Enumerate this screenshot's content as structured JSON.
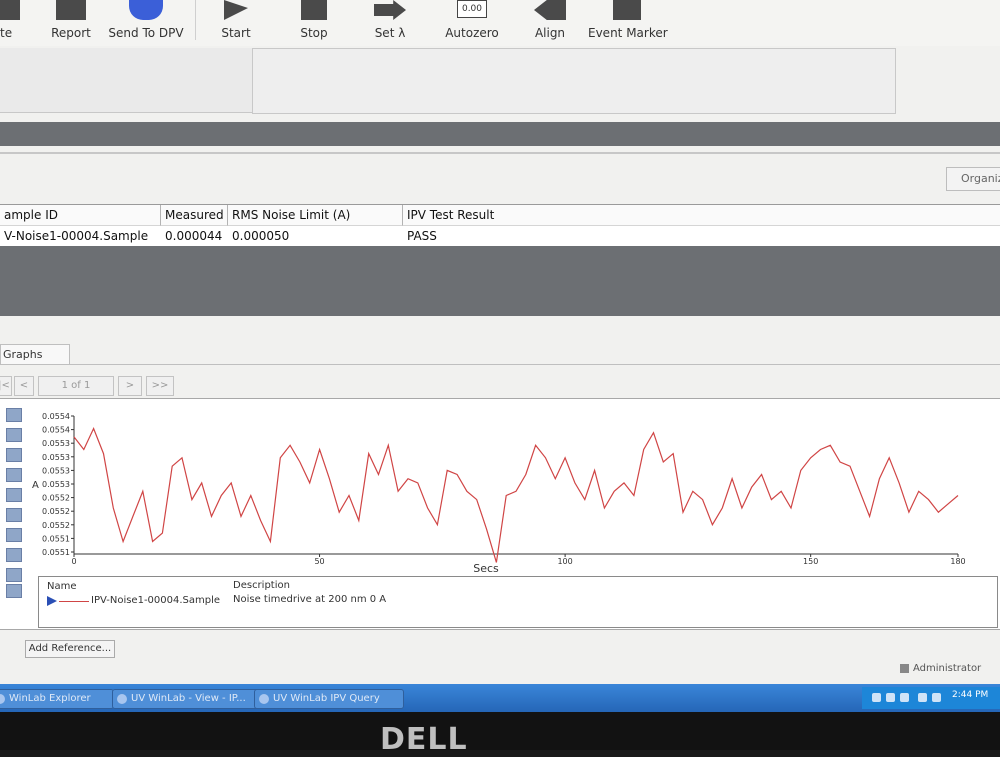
{
  "toolbar": {
    "buttons": [
      {
        "label": "te",
        "icon": "generic-icon"
      },
      {
        "label": "Report",
        "icon": "report-icon"
      },
      {
        "label": "Send To DPV",
        "icon": "send-icon"
      },
      {
        "label": "Start",
        "icon": "play-icon"
      },
      {
        "label": "Stop",
        "icon": "stop-icon"
      },
      {
        "label": "Set λ",
        "icon": "arrow-icon"
      },
      {
        "label": "Autozero",
        "icon": "autozero-icon",
        "icon_text": "0.00"
      },
      {
        "label": "Align",
        "icon": "align-icon"
      },
      {
        "label": "Event Marker",
        "icon": "marker-icon"
      }
    ]
  },
  "organize_label": "Organiz",
  "results": {
    "headers": [
      "ample ID",
      "Measured",
      "RMS Noise Limit (A)",
      "IPV Test Result"
    ],
    "rows": [
      [
        "V-Noise1-00004.Sample",
        "0.000044",
        "0.000050",
        "PASS"
      ]
    ]
  },
  "graphs": {
    "tab_label": "Graphs",
    "pager": {
      "first": "|<",
      "prev": "<",
      "page_text": "1 of 1",
      "next": ">",
      "last": ">>"
    },
    "add_reference": "Add Reference...",
    "legend": {
      "name_header": "Name",
      "description_header": "Description",
      "entry_name": "IPV-Noise1-00004.Sample",
      "entry_description": "Noise timedrive at 200 nm 0 A"
    }
  },
  "chart_data": {
    "type": "line",
    "xlabel": "Secs",
    "ylabel": "A",
    "xlim": [
      0,
      180
    ],
    "ylim": [
      0.05509,
      0.05542
    ],
    "x_ticks": [
      0,
      50,
      100,
      150,
      180
    ],
    "y_ticks": [
      "0.0554",
      "0.0554",
      "0.0553",
      "0.0553",
      "0.0553",
      "0.0553",
      "0.0552",
      "0.0552",
      "0.0552",
      "0.0551",
      "0.0551"
    ],
    "series_color": "#d04545",
    "series": [
      {
        "x": [
          0,
          2,
          4,
          6,
          8,
          10,
          12,
          14,
          16,
          18,
          20,
          22,
          24,
          26,
          28,
          30,
          32,
          34,
          36,
          38,
          40,
          42,
          44,
          46,
          48,
          50,
          52,
          54,
          56,
          58,
          60,
          62,
          64,
          66,
          68,
          70,
          72,
          74,
          76,
          78,
          80,
          82,
          84,
          86,
          88,
          90,
          92,
          94,
          96,
          98,
          100,
          102,
          104,
          106,
          108,
          110,
          112,
          114,
          116,
          118,
          120,
          122,
          124,
          126,
          128,
          130,
          132,
          134,
          136,
          138,
          140,
          142,
          144,
          146,
          148,
          150,
          152,
          154,
          156,
          158,
          160,
          162,
          164,
          166,
          168,
          170,
          172,
          174,
          176,
          178,
          180
        ],
        "y": [
          0.05537,
          0.05534,
          0.05539,
          0.05533,
          0.0552,
          0.05512,
          0.05518,
          0.05524,
          0.05512,
          0.05514,
          0.0553,
          0.05532,
          0.05522,
          0.05526,
          0.05518,
          0.05523,
          0.05526,
          0.05518,
          0.05523,
          0.05517,
          0.05512,
          0.05532,
          0.05535,
          0.05531,
          0.05526,
          0.05534,
          0.05527,
          0.05519,
          0.05523,
          0.05517,
          0.05533,
          0.05528,
          0.05535,
          0.05524,
          0.05527,
          0.05526,
          0.0552,
          0.05516,
          0.05529,
          0.05528,
          0.05524,
          0.05522,
          0.05515,
          0.05507,
          0.05523,
          0.05524,
          0.05528,
          0.05535,
          0.05532,
          0.05527,
          0.05532,
          0.05526,
          0.05522,
          0.05529,
          0.0552,
          0.05524,
          0.05526,
          0.05523,
          0.05534,
          0.05538,
          0.05531,
          0.05533,
          0.05519,
          0.05524,
          0.05522,
          0.05516,
          0.0552,
          0.05527,
          0.0552,
          0.05525,
          0.05528,
          0.05522,
          0.05524,
          0.0552,
          0.05529,
          0.05532,
          0.05534,
          0.05535,
          0.05531,
          0.0553,
          0.05524,
          0.05518,
          0.05527,
          0.05532,
          0.05526,
          0.05519,
          0.05524,
          0.05522,
          0.05519,
          0.05521,
          0.05523
        ]
      }
    ]
  },
  "status": {
    "user": "Administrator"
  },
  "taskbar": {
    "tasks": [
      "WinLab Explorer",
      "UV WinLab - View - IP...",
      "UV WinLab IPV Query"
    ],
    "clock": "2:44 PM"
  },
  "monitor": {
    "logo": "DELL"
  }
}
